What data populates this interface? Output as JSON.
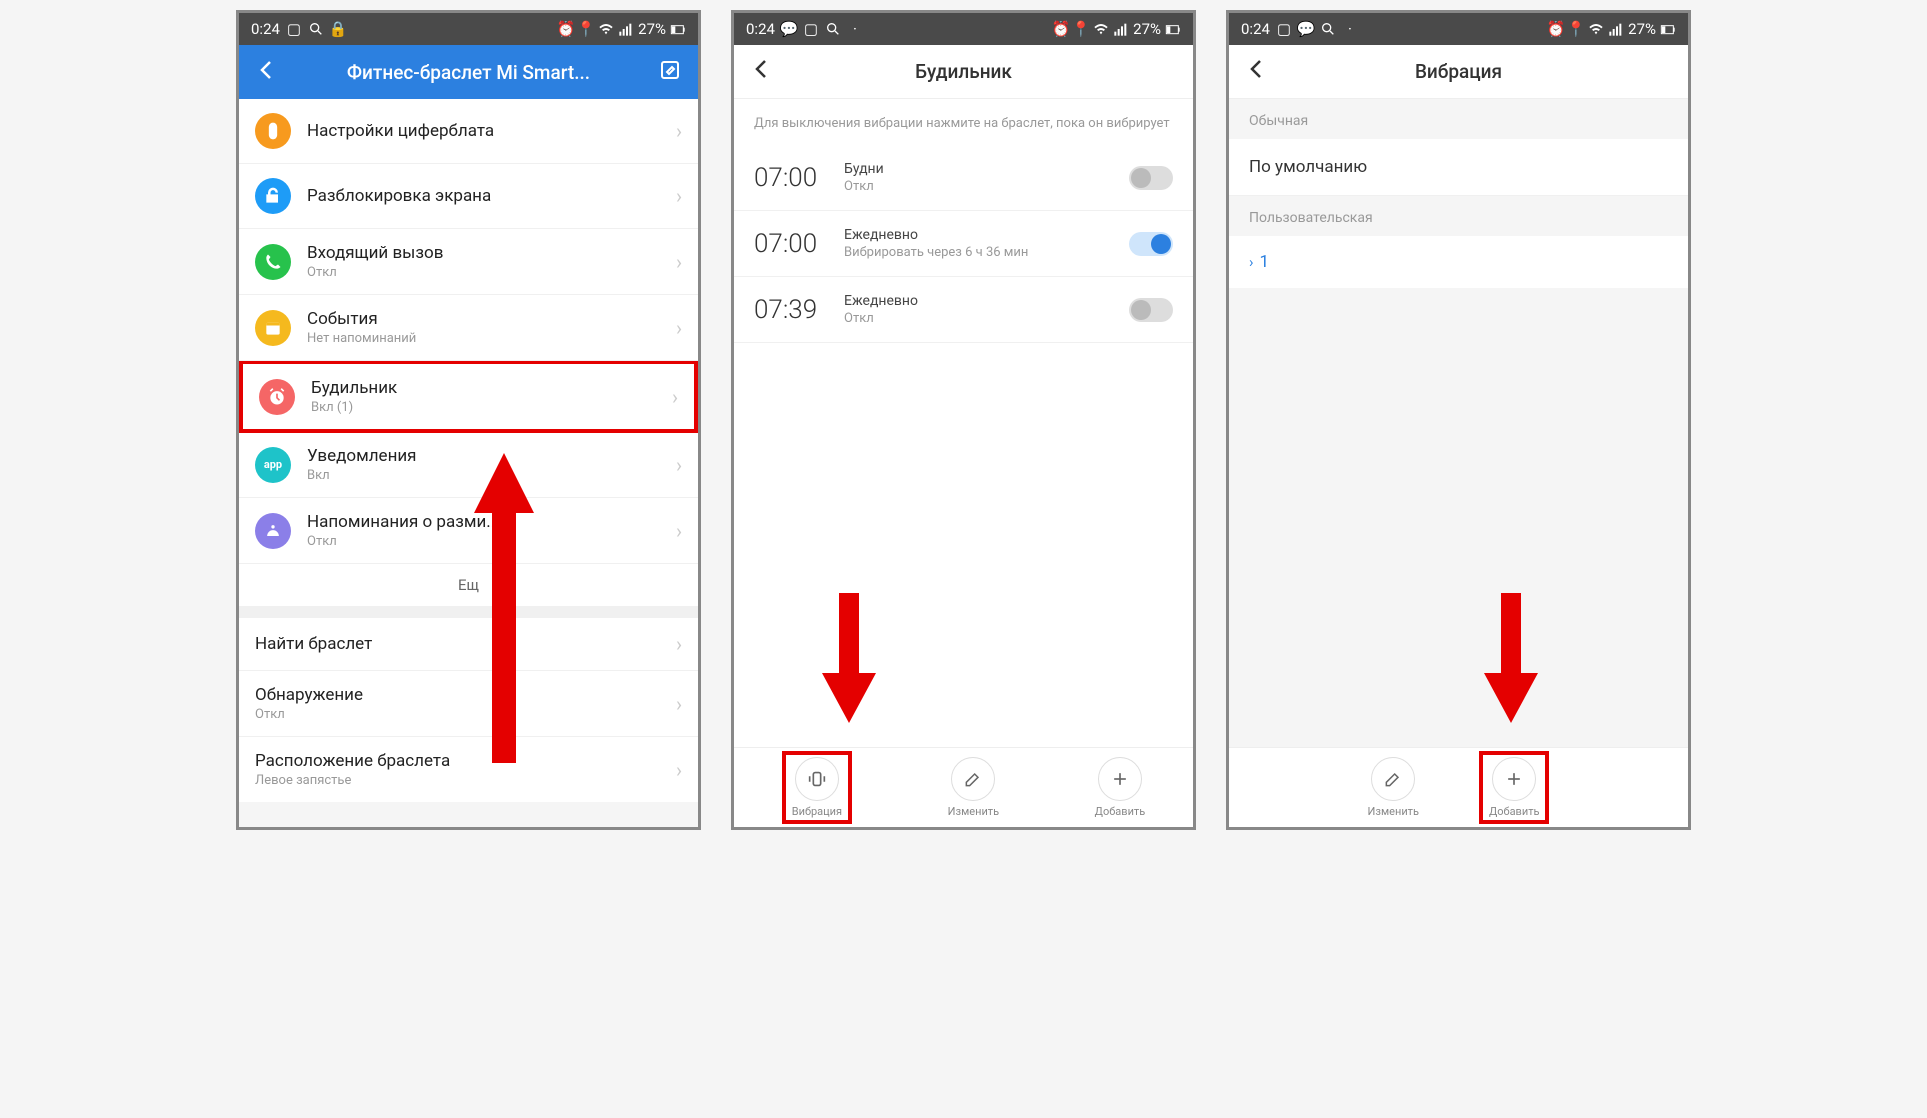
{
  "status": {
    "time": "0:24",
    "battery": "27%",
    "icons_left": [
      "image-icon",
      "search-icon",
      "lock-icon"
    ],
    "icons_left2": [
      "chat-icon",
      "image-icon",
      "search-icon",
      "dot-icon"
    ],
    "icons_left3": [
      "image-icon",
      "chat-icon",
      "search-icon",
      "dot-icon"
    ],
    "icons_right": [
      "alarm-icon",
      "location-icon",
      "wifi-icon",
      "signal-icon"
    ]
  },
  "screen1": {
    "title": "Фитнес-браслет Mi Smart...",
    "rows": [
      {
        "icon": "watchface-icon",
        "color": "ico-orange",
        "title": "Настройки циферблата",
        "sub": ""
      },
      {
        "icon": "unlock-icon",
        "color": "ico-blue",
        "title": "Разблокировка экрана",
        "sub": ""
      },
      {
        "icon": "call-icon",
        "color": "ico-green",
        "title": "Входящий вызов",
        "sub": "Откл"
      },
      {
        "icon": "events-icon",
        "color": "ico-yellow",
        "title": "События",
        "sub": "Нет напоминаний"
      },
      {
        "icon": "alarm-icon",
        "color": "ico-red",
        "title": "Будильник",
        "sub": "Вкл (1)",
        "highlight": true
      },
      {
        "icon": "notif-icon",
        "color": "ico-teal",
        "title": "Уведомления",
        "sub": "Вкл"
      },
      {
        "icon": "idle-icon",
        "color": "ico-purple",
        "title": "Напоминания о разми...",
        "sub": "Откл"
      }
    ],
    "more": "Ещ",
    "rows2": [
      {
        "title": "Найти браслет",
        "sub": ""
      },
      {
        "title": "Обнаружение",
        "sub": "Откл"
      },
      {
        "title": "Расположение браслета",
        "sub": "Левое запястье"
      }
    ]
  },
  "screen2": {
    "title": "Будильник",
    "info": "Для выключения вибрации нажмите на браслет, пока он вибрирует",
    "alarms": [
      {
        "time": "07:00",
        "l1": "Будни",
        "l2": "Откл",
        "on": false
      },
      {
        "time": "07:00",
        "l1": "Ежедневно",
        "l2": "Вибрировать через 6 ч 36 мин",
        "on": true
      },
      {
        "time": "07:39",
        "l1": "Ежедневно",
        "l2": "Откл",
        "on": false
      }
    ],
    "bottom": [
      {
        "icon": "vibration-icon",
        "label": "Вибрация",
        "highlight": true
      },
      {
        "icon": "edit-icon",
        "label": "Изменить",
        "highlight": false
      },
      {
        "icon": "plus-icon",
        "label": "Добавить",
        "highlight": false
      }
    ]
  },
  "screen3": {
    "title": "Вибрация",
    "section1": "Обычная",
    "row1": "По умолчанию",
    "section2": "Пользовательская",
    "row2": "1",
    "bottom": [
      {
        "icon": "edit-icon",
        "label": "Изменить",
        "highlight": false
      },
      {
        "icon": "plus-icon",
        "label": "Добавить",
        "highlight": true
      }
    ]
  }
}
